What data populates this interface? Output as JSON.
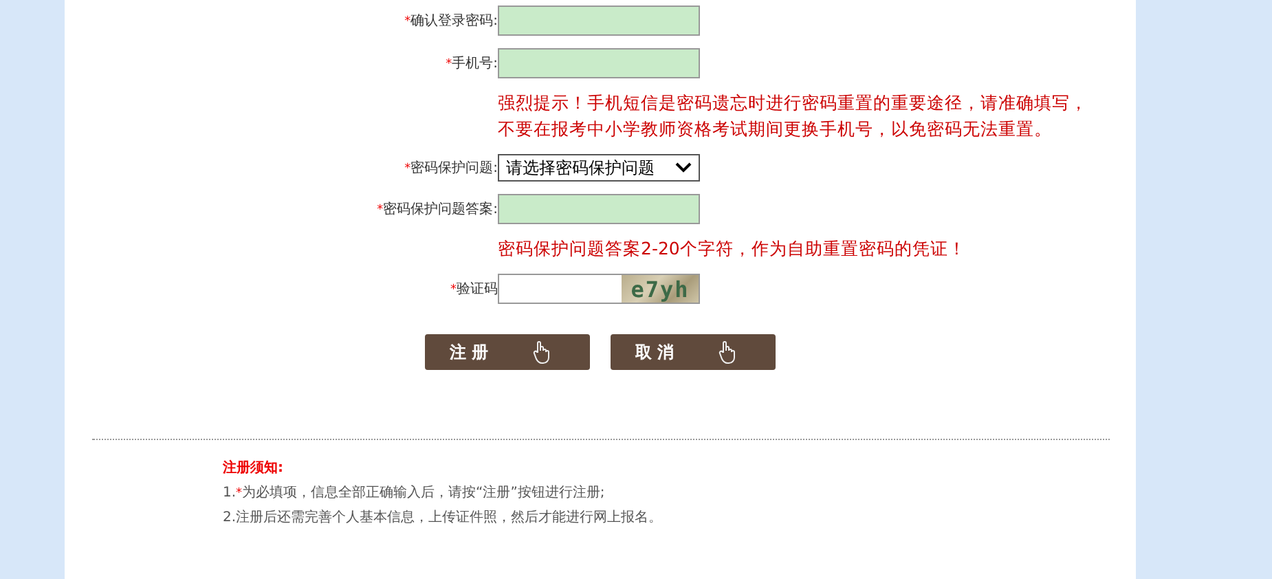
{
  "fields": [
    {
      "kind": "input",
      "mark": "*",
      "label": "确认登录密码:"
    },
    {
      "kind": "input",
      "mark": "*",
      "label": "手机号:",
      "hints": [
        "强烈提示！手机短信是密码遗忘时进行密码重置的重要途径，请准确填写，",
        "不要在报考中小学教师资格考试期间更换手机号，以免密码无法重置。"
      ]
    },
    {
      "kind": "select",
      "mark": "*",
      "label": "密码保护问题:",
      "value": "请选择密码保护问题"
    },
    {
      "kind": "input",
      "mark": "*",
      "label": "密码保护问题答案:",
      "hints": [
        "密码保护问题答案2-20个字符，作为自助重置密码的凭证！"
      ]
    },
    {
      "kind": "captcha",
      "mark": "*",
      "label": "验证码",
      "captcha_text": "e7yh"
    }
  ],
  "buttons": [
    {
      "label": "注 册"
    },
    {
      "label": "取 消"
    }
  ],
  "notes": {
    "title": "注册须知:",
    "items": [
      {
        "number": "1.",
        "mark": "*",
        "text": "为必填项，信息全部正确输入后，请按“注册”按钮进行注册;"
      },
      {
        "number": "2.",
        "text": "注册后还需完善个人基本信息，上传证件照，然后才能进行网上报名。"
      }
    ]
  }
}
